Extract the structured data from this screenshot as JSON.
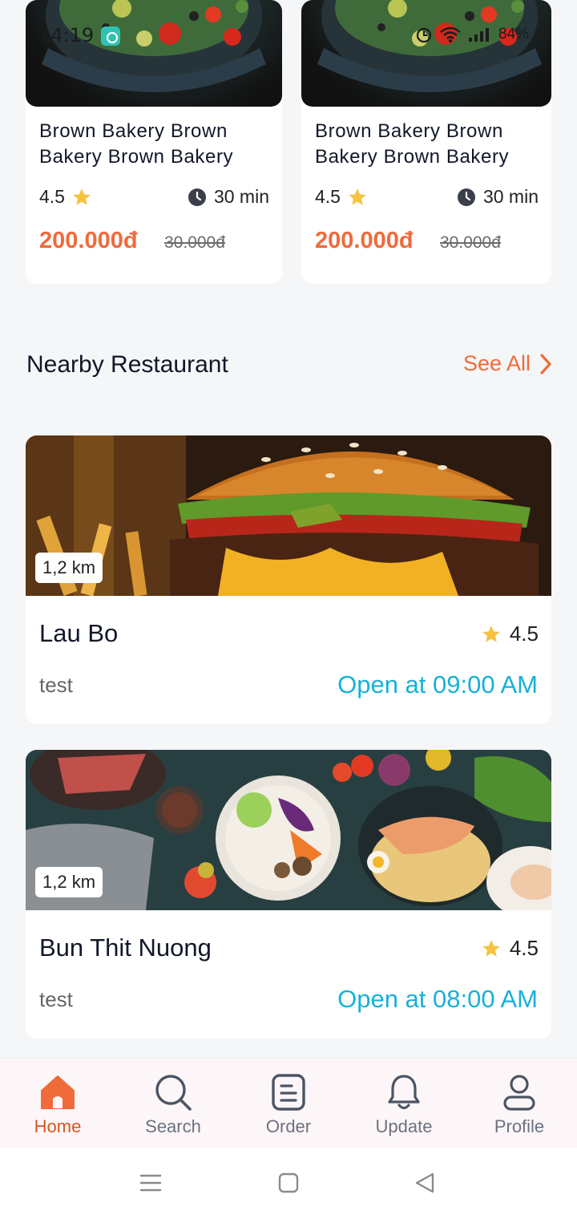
{
  "status_bar": {
    "time": "14:19",
    "battery": "84%"
  },
  "promo_cards": [
    {
      "title": "Brown Bakery Brown Bakery Brown Bakery",
      "rating": "4.5",
      "time": "30 min",
      "price": "200.000đ",
      "old_price": "30.000đ"
    },
    {
      "title": "Brown Bakery Brown Bakery Brown Bakery",
      "rating": "4.5",
      "time": "30 min",
      "price": "200.000đ",
      "old_price": "30.000đ"
    }
  ],
  "section": {
    "title": "Nearby Restaurant",
    "see_all": "See All"
  },
  "restaurants": [
    {
      "name": "Lau Bo",
      "rating": "4.5",
      "distance": "1,2 km",
      "description": "test",
      "open_text": "Open at 09:00 AM"
    },
    {
      "name": "Bun Thit Nuong",
      "rating": "4.5",
      "distance": "1,2 km",
      "description": "test",
      "open_text": "Open at 08:00 AM"
    }
  ],
  "bottom_nav": {
    "items": [
      {
        "label": "Home",
        "icon": "home-icon",
        "active": true
      },
      {
        "label": "Search",
        "icon": "search-icon",
        "active": false
      },
      {
        "label": "Order",
        "icon": "order-icon",
        "active": false
      },
      {
        "label": "Update",
        "icon": "bell-icon",
        "active": false
      },
      {
        "label": "Profile",
        "icon": "profile-icon",
        "active": false
      }
    ]
  },
  "colors": {
    "accent": "#ef6b3a",
    "open_text": "#17b1d9",
    "star": "#f5c242",
    "background": "#f5f6f8"
  }
}
